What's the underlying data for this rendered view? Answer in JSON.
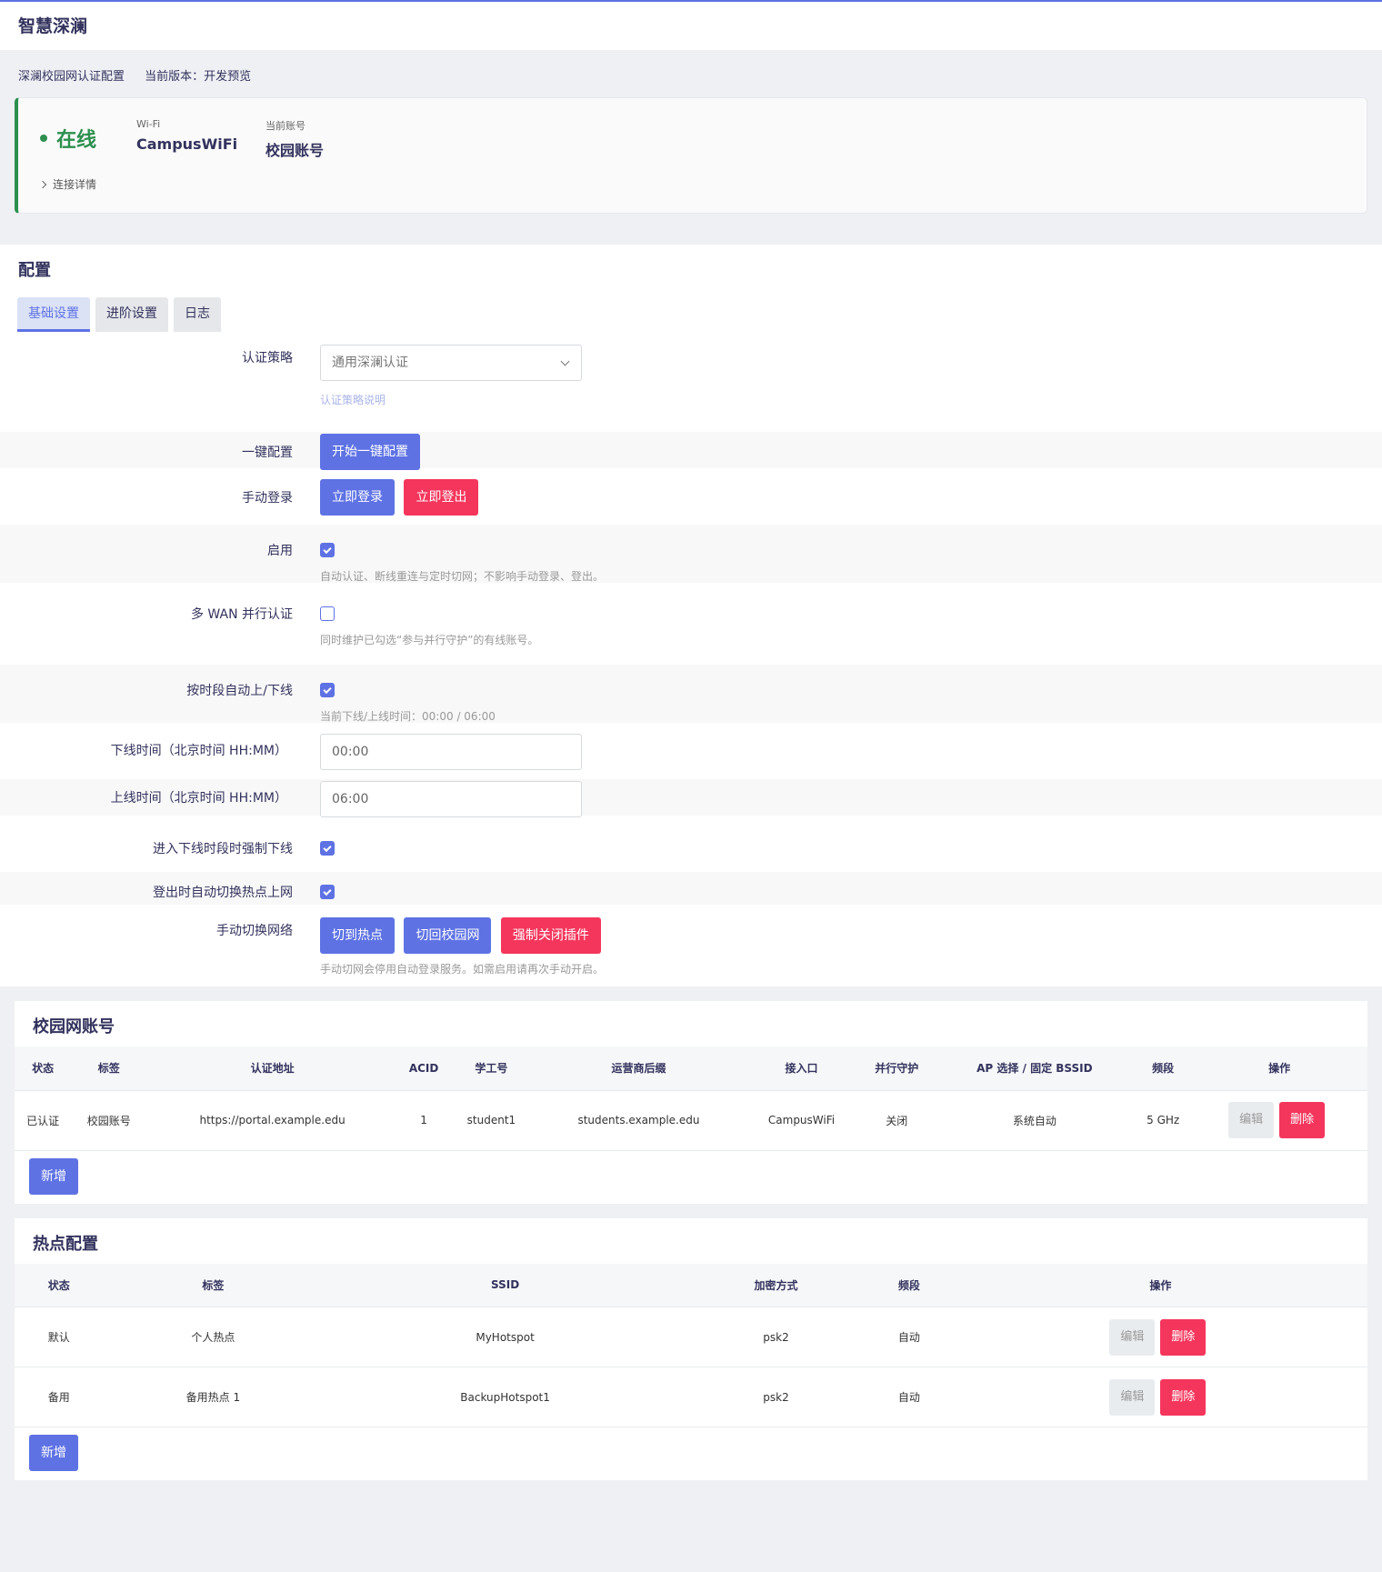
{
  "app": {
    "title": "智慧深澜"
  },
  "subheader": {
    "name": "深澜校园网认证配置",
    "version": "当前版本：开发预览"
  },
  "status": {
    "online_label": "在线",
    "wifi_label": "Wi-Fi",
    "wifi_value": "CampusWiFi",
    "account_label": "当前账号",
    "account_value": "校园账号",
    "detail_link": "连接详情",
    "online_color": "#2d8f4e"
  },
  "config": {
    "title": "配置",
    "tabs": [
      {
        "label": "基础设置",
        "active": true
      },
      {
        "label": "进阶设置",
        "active": false
      },
      {
        "label": "日志",
        "active": false
      }
    ],
    "auth_strategy": {
      "label": "认证策略",
      "value": "通用深澜认证",
      "hint": "认证策略说明"
    },
    "one_click": {
      "label": "一键配置",
      "button": "开始一键配置"
    },
    "manual_login": {
      "label": "手动登录",
      "login_button": "立即登录",
      "logout_button": "立即登出"
    },
    "enable": {
      "label": "启用",
      "checked": true,
      "hint": "自动认证、断线重连与定时切网；不影响手动登录、登出。"
    },
    "multi_wan": {
      "label": "多 WAN 并行认证",
      "checked": false,
      "hint": "同时维护已勾选“参与并行守护”的有线账号。"
    },
    "schedule": {
      "label": "按时段自动上/下线",
      "checked": true,
      "hint": "当前下线/上线时间：00:00 / 06:00"
    },
    "offline_time": {
      "label": "下线时间（北京时间 HH:MM）",
      "value": "00:00"
    },
    "online_time": {
      "label": "上线时间（北京时间 HH:MM）",
      "value": "06:00"
    },
    "force_offline": {
      "label": "进入下线时段时强制下线",
      "checked": true
    },
    "auto_hotspot": {
      "label": "登出时自动切换热点上网",
      "checked": true
    },
    "manual_switch": {
      "label": "手动切换网络",
      "to_hotspot": "切到热点",
      "to_campus": "切回校园网",
      "force_close": "强制关闭插件",
      "hint": "手动切网会停用自动登录服务。如需启用请再次手动开启。"
    }
  },
  "accounts": {
    "title": "校园网账号",
    "columns": [
      "状态",
      "标签",
      "认证地址",
      "ACID",
      "学工号",
      "运营商后缀",
      "接入口",
      "并行守护",
      "AP 选择 / 固定 BSSID",
      "频段",
      "操作"
    ],
    "rows": [
      [
        "已认证",
        "校园账号",
        "https://portal.example.edu",
        "1",
        "student1",
        "students.example.edu",
        "CampusWiFi",
        "关闭",
        "系统自动",
        "5 GHz"
      ]
    ],
    "edit_label": "编辑",
    "delete_label": "删除",
    "add_label": "新增"
  },
  "hotspots": {
    "title": "热点配置",
    "columns": [
      "状态",
      "标签",
      "SSID",
      "加密方式",
      "频段",
      "操作"
    ],
    "rows": [
      [
        "默认",
        "个人热点",
        "MyHotspot",
        "psk2",
        "自动"
      ],
      [
        "备用",
        "备用热点 1",
        "BackupHotspot1",
        "psk2",
        "自动"
      ]
    ],
    "edit_label": "编辑",
    "delete_label": "删除",
    "add_label": "新增"
  },
  "colors": {
    "primary": "#5e72e4",
    "danger": "#f5365c",
    "title": "#32325d"
  }
}
